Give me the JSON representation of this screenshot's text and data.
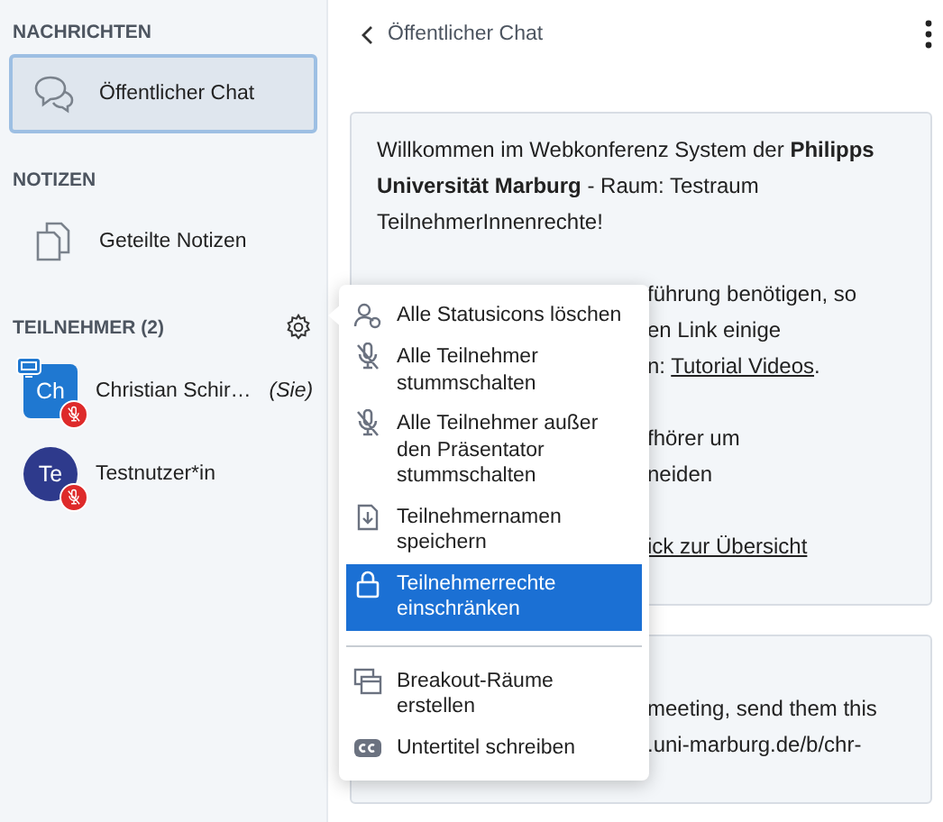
{
  "sidebar": {
    "messages_heading": "NACHRICHTEN",
    "public_chat": {
      "label": "Öffentlicher Chat",
      "selected": true
    },
    "notes_heading": "NOTIZEN",
    "shared_notes": {
      "label": "Geteilte Notizen",
      "selected": false
    },
    "participants_heading": "TEILNEHMER (2)",
    "users": [
      {
        "initials": "Ch",
        "name": "Christian Schir…",
        "suffix": "(Sie)",
        "kind": "moderator",
        "color": "#1f78d1",
        "presenter": true,
        "muted": true
      },
      {
        "initials": "Te",
        "name": "Testnutzer*in",
        "kind": "viewer",
        "color": "#2e3a8c",
        "presenter": false,
        "muted": true
      }
    ]
  },
  "chat": {
    "title": "Öffentlicher Chat",
    "messages": [
      {
        "intro": "Willkommen im Webkonferenz System der **Philipps Universität Marburg** - Raum: Testraum TeilnehmerInnenrechte!",
        "covered_lines": [
          {
            "gap_before": false,
            "segments": [
              {
                "text": "führung benötigen, so",
                "link": false
              }
            ]
          },
          {
            "gap_before": false,
            "segments": [
              {
                "text": "en Link einige",
                "link": false
              }
            ]
          },
          {
            "gap_before": false,
            "segments": [
              {
                "text": "n: ",
                "link": false
              },
              {
                "text": "Tutorial Videos",
                "link": true
              },
              {
                "text": ".",
                "link": false
              }
            ]
          },
          {
            "gap_before": true,
            "segments": [
              {
                "text": "fhörer um",
                "link": false
              }
            ]
          },
          {
            "gap_before": false,
            "segments": [
              {
                "text": "neiden",
                "link": false
              }
            ]
          },
          {
            "gap_before": true,
            "segments": [
              {
                "text": "ick zur Übersicht",
                "link": true
              }
            ]
          }
        ]
      },
      {
        "covered_lines": [
          {
            "gap_before": true,
            "segments": [
              {
                "text": "meeting, send them this",
                "link": false
              }
            ]
          },
          {
            "gap_before": false,
            "segments": [
              {
                "text": ".uni-marburg.de/b/chr-",
                "link": false
              }
            ]
          }
        ]
      }
    ]
  },
  "menu_groups": [
    [
      {
        "kind": "clear-status",
        "label": "Alle Statusicons löschen",
        "selected": false
      },
      {
        "kind": "mute",
        "label": "Alle Teilnehmer stummschalten",
        "selected": false
      },
      {
        "kind": "mute",
        "label": "Alle Teilnehmer außer den Präsentator stummschalten",
        "selected": false
      },
      {
        "kind": "save",
        "label": "Teilnehmernamen speichern",
        "selected": false
      },
      {
        "kind": "lock",
        "label": "Teilnehmerrechte einschränken",
        "selected": true
      }
    ],
    [
      {
        "kind": "breakout",
        "label": "Breakout-Räume erstellen",
        "selected": false
      },
      {
        "kind": "captions",
        "label": "Untertitel schreiben",
        "selected": false
      }
    ]
  ]
}
